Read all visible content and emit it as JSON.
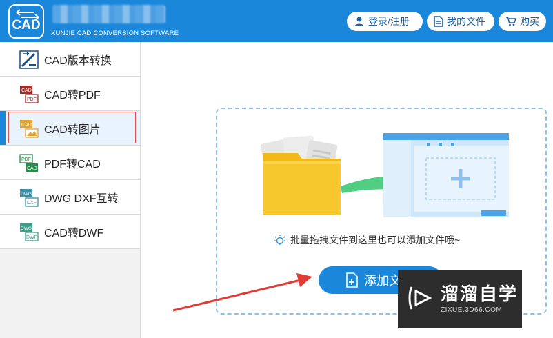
{
  "app": {
    "logo_text": "CAD",
    "subtitle": "XUNJIE CAD CONVERSION SOFTWARE"
  },
  "header": {
    "login_label": "登录/注册",
    "files_label": "我的文件",
    "buy_label": "购买"
  },
  "sidebar": {
    "items": [
      {
        "label": "CAD版本转换",
        "icon": "cad-version-icon"
      },
      {
        "label": "CAD转PDF",
        "icon": "cad-to-pdf-icon"
      },
      {
        "label": "CAD转图片",
        "icon": "cad-to-image-icon",
        "active": true
      },
      {
        "label": "PDF转CAD",
        "icon": "pdf-to-cad-icon"
      },
      {
        "label": "DWG DXF互转",
        "icon": "dwg-dxf-icon"
      },
      {
        "label": "CAD转DWF",
        "icon": "cad-to-dwf-icon"
      }
    ]
  },
  "main": {
    "hint": "批量拖拽文件到这里也可以添加文件哦~",
    "add_button": "添加文件"
  },
  "watermark": {
    "title": "溜溜自学",
    "url": "ZIXUE.3D66.COM"
  },
  "colors": {
    "brand": "#1a87db",
    "active_outline": "#d5534f",
    "arrow_red": "#e23b35",
    "folder_yellow": "#f7c72e",
    "arrow_green": "#4fce82"
  }
}
